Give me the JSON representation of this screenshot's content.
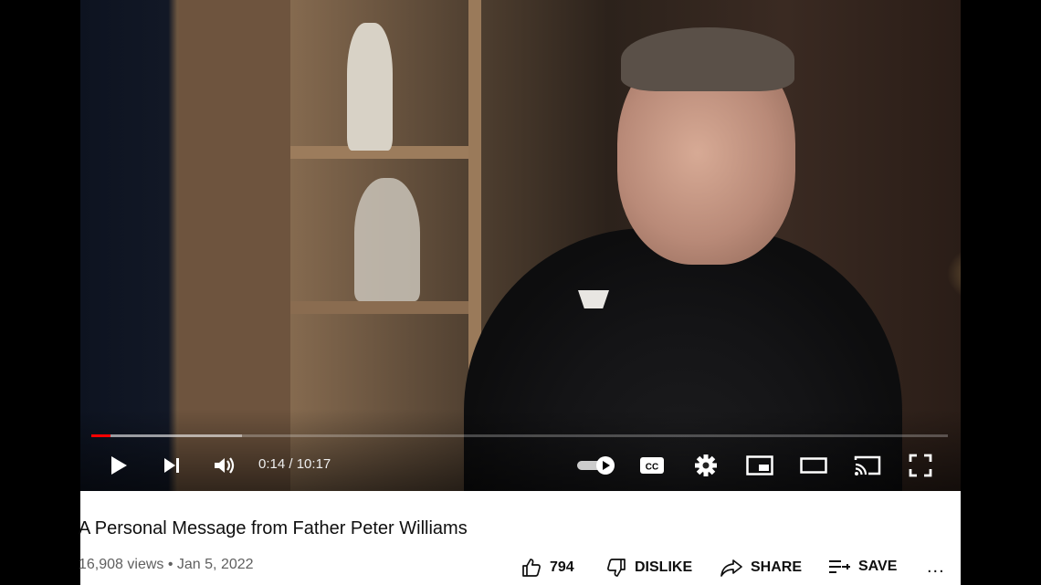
{
  "player": {
    "current_time": "0:14",
    "separator": "/",
    "duration": "10:17",
    "progress_played": 0.022,
    "progress_buffered": 0.176,
    "progress_color": "#ff0000",
    "autoplay_on": true,
    "icons": {
      "play": "play-icon",
      "next": "skip-next-icon",
      "volume": "volume-icon",
      "autoplay": "autoplay-toggle-icon",
      "subtitles": "closed-captions-icon",
      "settings": "gear-icon",
      "miniplayer": "miniplayer-icon",
      "theater": "theater-mode-icon",
      "cast": "cast-icon",
      "fullscreen": "fullscreen-icon"
    }
  },
  "video": {
    "title": "A Personal Message from Father Peter Williams",
    "views": "16,908 views",
    "dot": "•",
    "date": "Jan 5, 2022"
  },
  "actions": {
    "like_count": "794",
    "dislike_label": "DISLIKE",
    "share_label": "SHARE",
    "save_label": "SAVE",
    "more_label": "..."
  }
}
